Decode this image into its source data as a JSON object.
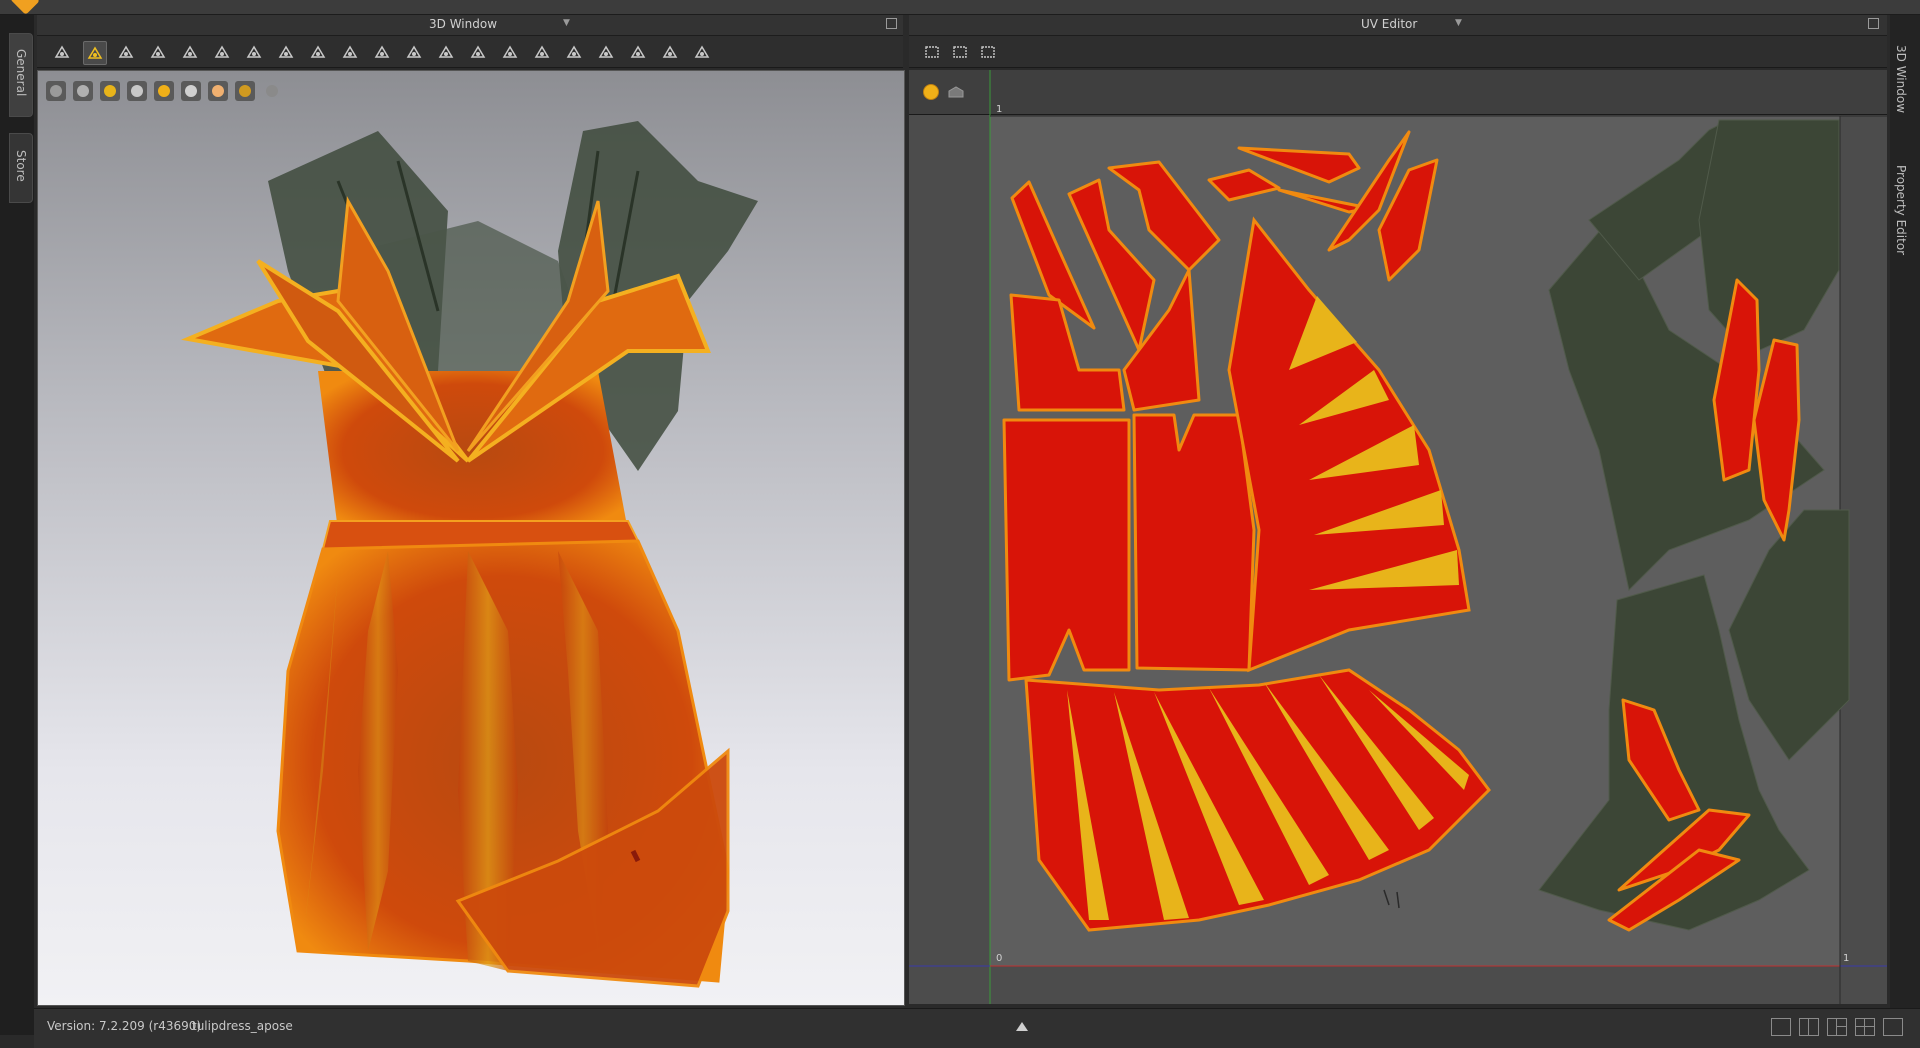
{
  "app": {
    "logo_color": "#f0a020"
  },
  "left_tabs": [
    {
      "label": "General"
    },
    {
      "label": "Store"
    }
  ],
  "right_tabs": [
    {
      "label": "3D Window"
    },
    {
      "label": "Property Editor"
    }
  ],
  "panels": {
    "window3d": {
      "title": "3D Window"
    },
    "uv_editor": {
      "title": "UV Editor"
    }
  },
  "toolbar_3d": {
    "tools": [
      "select-mesh-icon",
      "transform-pattern-icon",
      "edit-pattern-icon",
      "tack-icon",
      "pin-icon",
      "fold-icon",
      "arrangement-icon",
      "strap-icon",
      "button-icon",
      "topstitch-icon",
      "puckering-icon",
      "mesh-grid-icon",
      "edit-texture-icon",
      "zipper-icon",
      "piping-icon",
      "measure-icon",
      "sewing-icon",
      "line-icon",
      "seam-icon",
      "hanging-icon",
      "avatar-run-icon"
    ],
    "active_index": 1
  },
  "viewport_icons": [
    "display-avatar-icon",
    "display-garment-icon",
    "display-texture-icon",
    "display-fabric-icon",
    "display-strain-icon",
    "display-fit-icon",
    "display-skin-icon",
    "display-light-icon",
    "display-ground-icon"
  ],
  "uv_toolbar": {
    "tools": [
      "uv-select-icon",
      "uv-transform-icon",
      "uv-arrange-icon"
    ]
  },
  "uv_top_icons": [
    "light-bulb-icon",
    "texture-plane-icon"
  ],
  "uv_axes": {
    "top_left_label": "1",
    "bottom_left_label": "0",
    "bottom_right_label": "1"
  },
  "colors": {
    "red": "#d81408",
    "yellow": "#e8b41a",
    "dark_green": "#3c4636",
    "orange": "#e0540c"
  },
  "status": {
    "version_label": "Version:",
    "version_value": "7.2.209 (r43690)",
    "file_name": "tulipdress_apose"
  },
  "bottom_layout_icons": [
    "single-view-icon",
    "dual-view-icon",
    "triple-view-icon",
    "quad-view-icon",
    "reset-view-icon"
  ]
}
